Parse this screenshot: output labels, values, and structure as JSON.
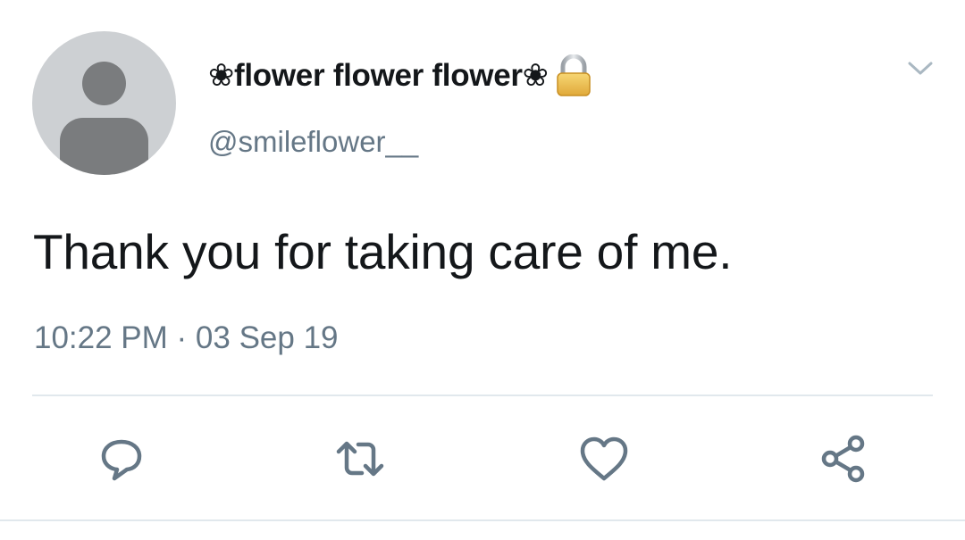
{
  "tweet": {
    "display_name": "❀flower flower flower❀",
    "handle": "@smileflower__",
    "text": "Thank you for taking care of me.",
    "timestamp": "10:22 PM · 03 Sep 19",
    "protected_icon": "lock-icon",
    "menu_icon": "chevron-down-icon"
  },
  "actions": [
    {
      "name": "reply",
      "icon": "comment-icon"
    },
    {
      "name": "retweet",
      "icon": "retweet-icon"
    },
    {
      "name": "like",
      "icon": "heart-icon"
    },
    {
      "name": "share",
      "icon": "share-icon"
    }
  ],
  "colors": {
    "text_primary": "#14171a",
    "text_secondary": "#657786",
    "icon": "#657786",
    "divider": "#e1e8ed",
    "avatar_bg": "#cdd0d3",
    "avatar_fg": "#7a7c7e"
  }
}
